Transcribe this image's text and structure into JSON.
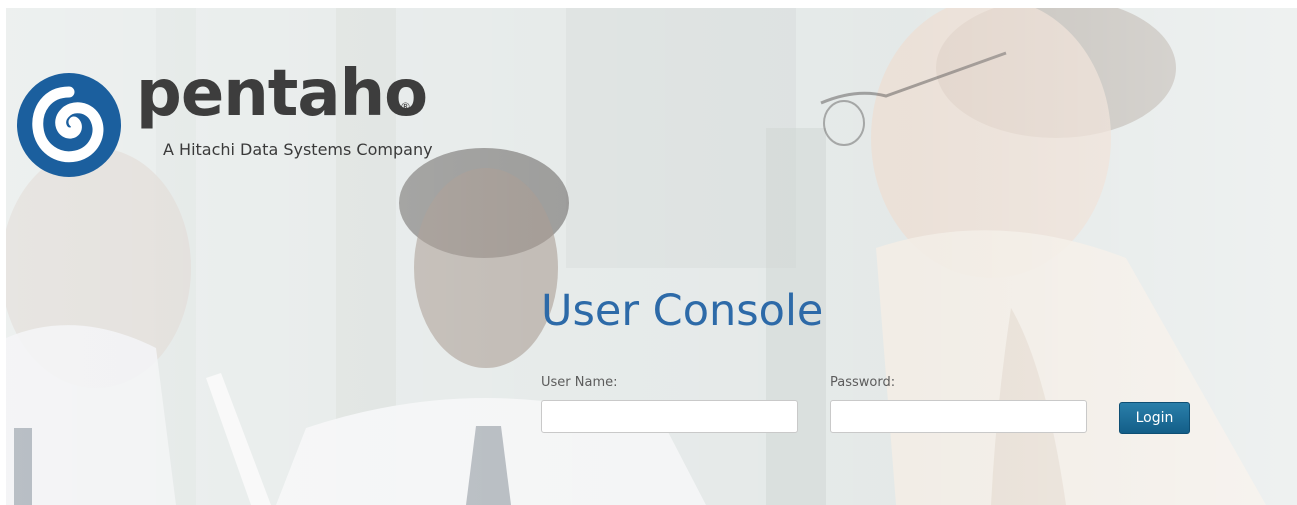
{
  "brand": {
    "name": "pentaho",
    "registered_mark": "®",
    "tagline": "A Hitachi Data Systems Company"
  },
  "login": {
    "title": "User Console",
    "username_label": "User Name:",
    "username_value": "",
    "password_label": "Password:",
    "password_value": "",
    "submit_label": "Login"
  },
  "colors": {
    "title_blue": "#2d6aa8",
    "logo_blue": "#1b5f9e",
    "button_blue": "#135e88",
    "logo_text": "#3d3d3d"
  },
  "icons": {
    "logo_mark": "pentaho-swirl-icon"
  }
}
